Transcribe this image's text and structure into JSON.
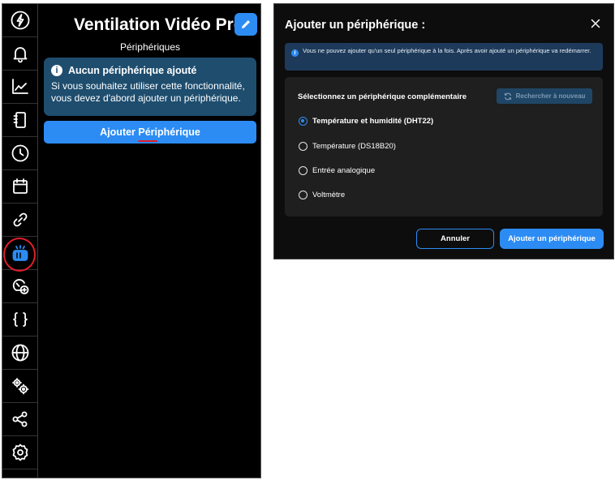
{
  "left_panel": {
    "app_title": "Ventilation Vidéo Pro",
    "subtitle": "Périphériques",
    "info_card": {
      "heading": "Aucun périphérique ajouté",
      "text": "Si vous souhaitez utiliser cette fonctionnalité, vous devez d'abord ajouter un périphérique."
    },
    "add_button_label": "Ajouter Périphérique",
    "sidebar_icons": [
      "power-bolt-icon",
      "bell-icon",
      "chart-line-icon",
      "notebook-icon",
      "clock-icon",
      "calendar-icon",
      "link-icon",
      "device-icon",
      "gauge-add-icon",
      "code-braces-icon",
      "globe-icon",
      "gears-icon",
      "share-icon",
      "settings-icon"
    ],
    "active_item": "device-icon",
    "accent_color": "#2c8cf4",
    "highlight_color": "#e01e2a"
  },
  "dialog": {
    "title": "Ajouter un périphérique :",
    "alert_text": "Vous ne pouvez ajouter qu'un seul périphérique à la fois. Après avoir ajouté un périphérique va redémarrer.",
    "select_label": "Sélectionnez un périphérique complémentaire",
    "refresh_label": "Rechercher à nouveau",
    "options": [
      {
        "label": "Température et humidité (DHT22)",
        "selected": true
      },
      {
        "label": "Température (DS18B20)",
        "selected": false
      },
      {
        "label": "Entrée analogique",
        "selected": false
      },
      {
        "label": "Voltmètre",
        "selected": false
      }
    ],
    "cancel_label": "Annuler",
    "confirm_label": "Ajouter un périphérique"
  }
}
